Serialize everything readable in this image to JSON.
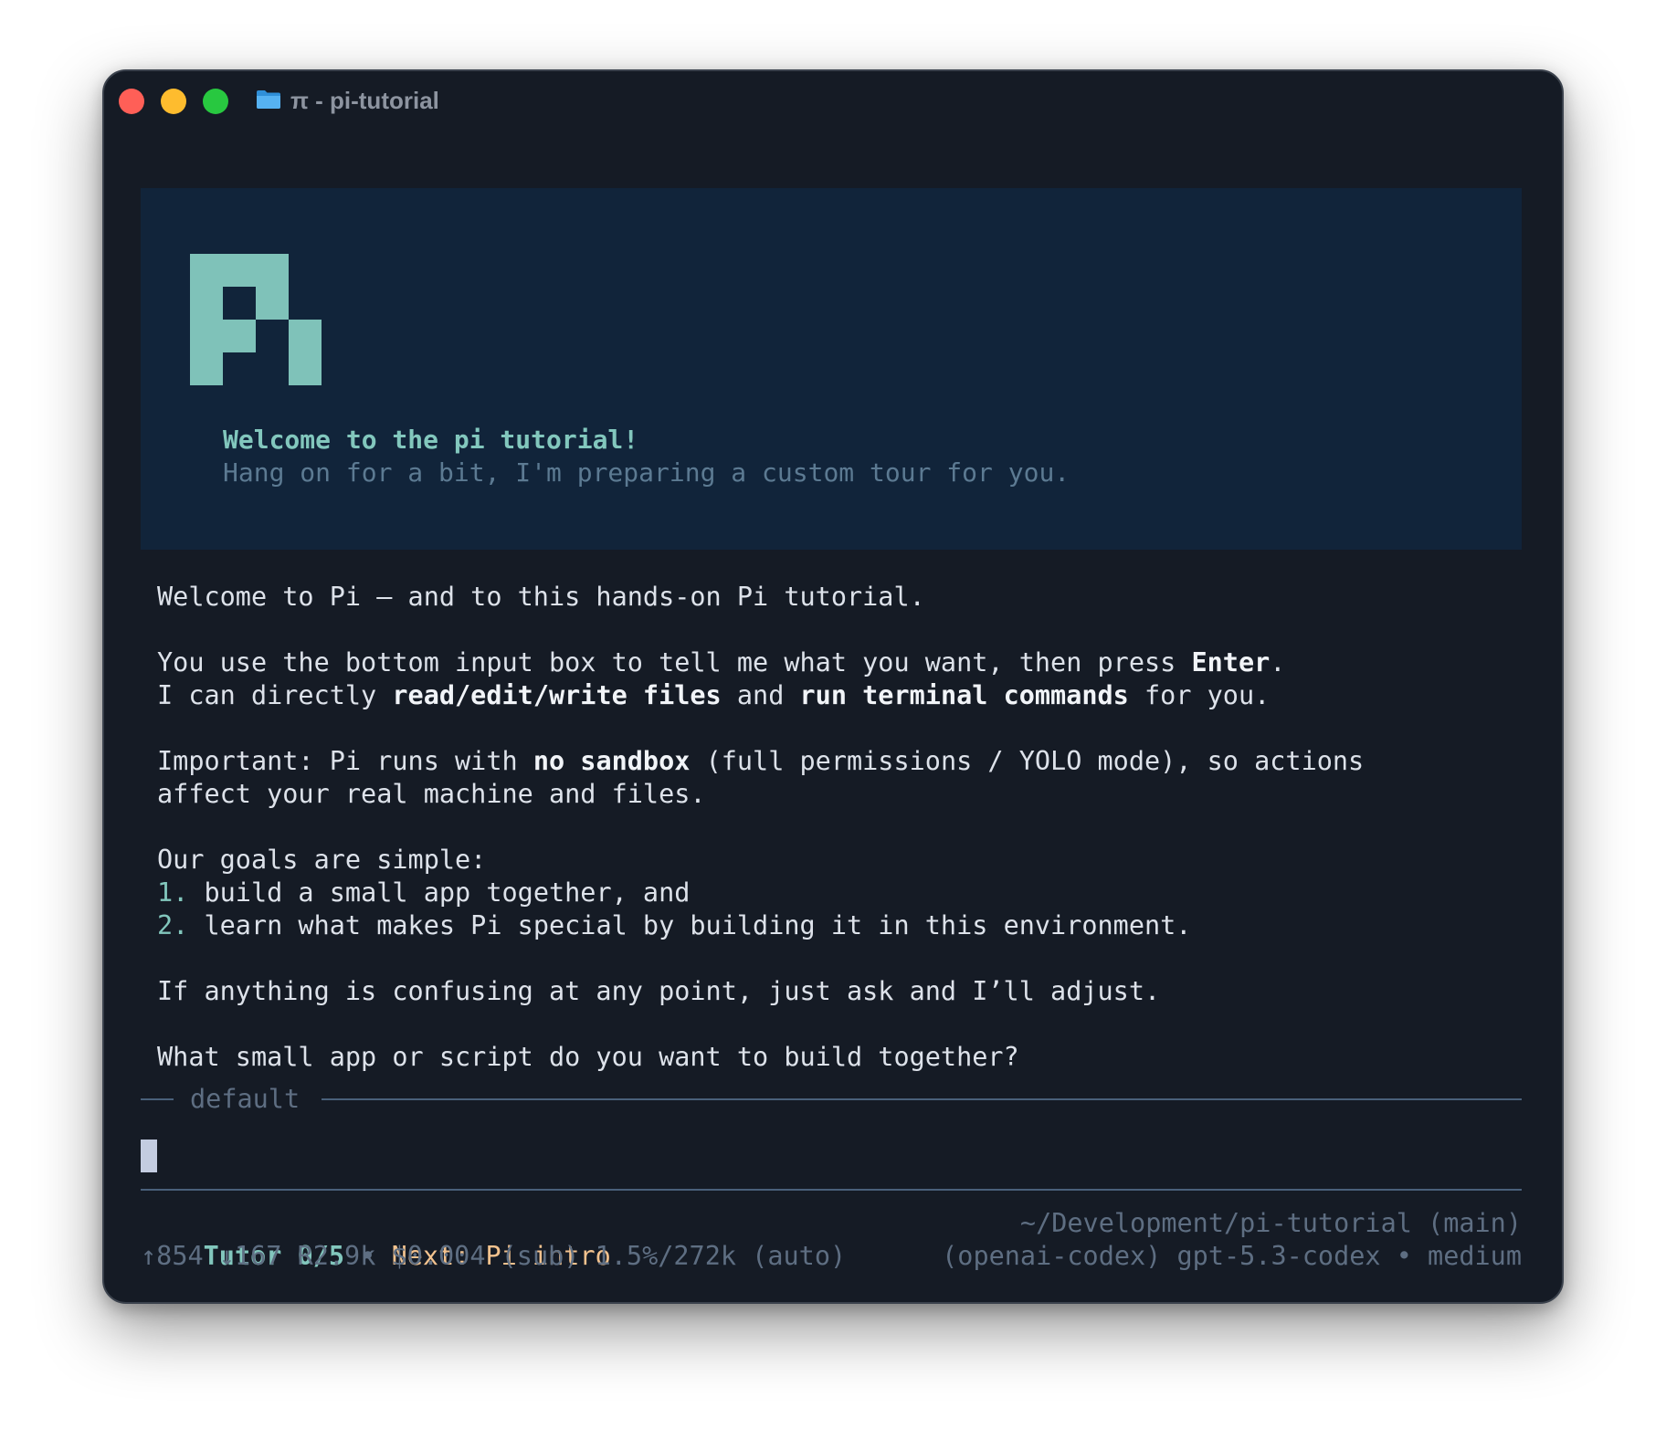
{
  "window": {
    "title": "π - pi-tutorial",
    "icon": "folder-icon"
  },
  "banner": {
    "title": "Welcome to the pi tutorial!",
    "subtitle": "Hang on for a bit, I'm preparing a custom tour for you."
  },
  "message": {
    "line1": "Welcome to Pi — and to this hands-on Pi tutorial.",
    "l2a": "You use the bottom input box to tell me what you want, then press ",
    "l2b": "Enter",
    "l2c": ".",
    "l3a": "I can directly ",
    "l3b": "read/edit/write files",
    "l3c": " and ",
    "l3d": "run terminal commands",
    "l3e": " for you.",
    "l4a": "Important: Pi runs with ",
    "l4b": "no sandbox",
    "l4c": " (full permissions / YOLO mode), so actions",
    "l5": "affect your real machine and files.",
    "l6": "Our goals are simple:",
    "goals": [
      {
        "num": "1.",
        "text": " build a small app together, and"
      },
      {
        "num": "2.",
        "text": " learn what makes Pi special by building it in this environment."
      }
    ],
    "l7": "If anything is confusing at any point, just ask and I’ll adjust.",
    "l8": "What small app or script do you want to build together?"
  },
  "editor": {
    "label": "default",
    "value": ""
  },
  "status": {
    "tutor": "Tutor 0/5",
    "separator": " • ",
    "next": "Next: Pi intro",
    "path": "~/Development/pi-tutorial (main)",
    "usage": "↑854 ↓167 R2.9k $0.004 (sub) 1.5%/272k (auto)",
    "model": "(openai-codex) gpt-5.3-codex • medium"
  },
  "colors": {
    "background": "#151b25",
    "banner": "#11243a",
    "accent": "#82c7bd",
    "next": "#f2c28e",
    "muted": "#5e6e82"
  }
}
